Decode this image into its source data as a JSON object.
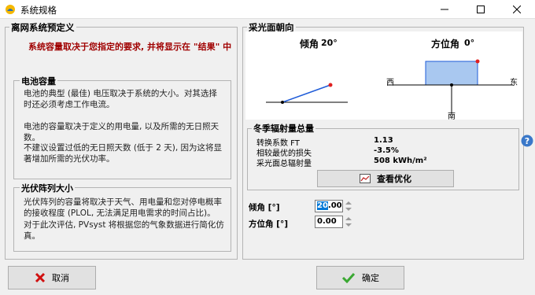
{
  "window": {
    "title": "系统规格"
  },
  "left": {
    "title": "离网系统预定义",
    "warning": "系统容量取决于您指定的要求, 并将显示在 \"结果\" 中",
    "battery": {
      "title": "电池容量",
      "p1": "电池的典型 (最佳) 电压取决于系统的大小。对其选择时还必须考虑工作电流。",
      "p2": "电池的容量取决于定义的用电量, 以及所需的无日照天数。",
      "p3": "不建议设置过低的无日照天数 (低于 2 天), 因为这将显著增加所需的光伏功率。"
    },
    "pv": {
      "title": "光伏阵列大小",
      "p1": "光伏阵列的容量将取决于天气、用电量和您对停电概率的接收程度 (PLOL, 无法满足用电需求的时间占比)。",
      "p2": "对于此次评估, PVsyst 将根据您的气象数据进行简化仿真。"
    }
  },
  "right": {
    "title": "采光面朝向",
    "tilt_caption": "倾角",
    "tilt_value": "20°",
    "azimuth_caption": "方位角",
    "azimuth_value": "0°",
    "west": "西",
    "east": "东",
    "south": "南",
    "winter": {
      "title": "冬季辐射量总量",
      "rows": [
        {
          "label": "转换系数 FT",
          "value": "1.13"
        },
        {
          "label": "相较最优的损失",
          "value": "-3.5%"
        },
        {
          "label": "采光面总辐射量",
          "value": "508 kWh/m²"
        }
      ],
      "optimize_button": "查看优化"
    },
    "tilt_field": {
      "label": "倾角 [°]",
      "value": "20.00"
    },
    "azimuth_field": {
      "label": "方位角 [°]",
      "value": "0.00"
    }
  },
  "buttons": {
    "cancel": "取消",
    "ok": "确定"
  }
}
